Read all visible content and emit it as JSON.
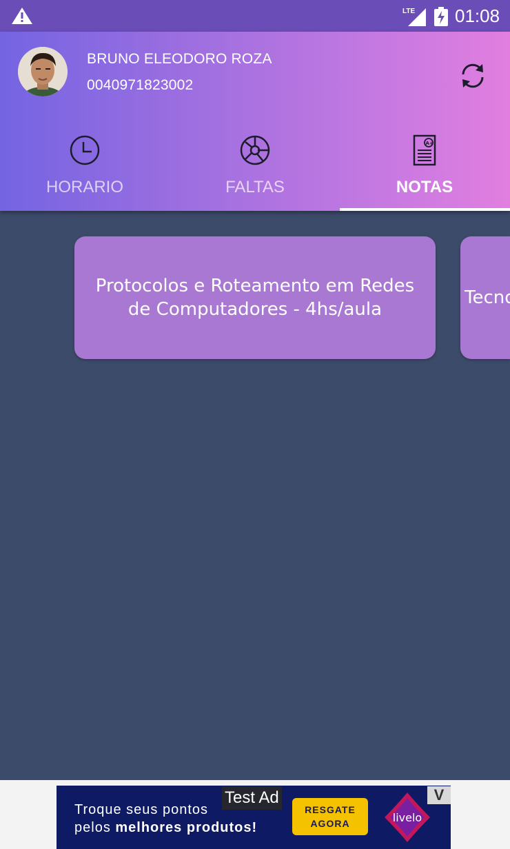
{
  "status_bar": {
    "network": "LTE",
    "time": "01:08",
    "icons": [
      "warning-icon",
      "lte-signal-icon",
      "battery-charging-icon"
    ]
  },
  "user": {
    "name": "BRUNO ELEODORO ROZA",
    "id": "0040971823002"
  },
  "header": {
    "refresh_icon": "refresh-icon"
  },
  "tabs": [
    {
      "label": "HORARIO",
      "icon": "clock-icon",
      "active": false
    },
    {
      "label": "FALTAS",
      "icon": "pie-chart-icon",
      "active": false
    },
    {
      "label": "NOTAS",
      "icon": "grade-report-icon",
      "active": true
    }
  ],
  "cards": [
    {
      "title": "Protocolos e Roteamento em Redes de Computadores - 4hs/aula"
    },
    {
      "title": "Tecno"
    }
  ],
  "ad": {
    "label": "Test Ad",
    "line1_prefix": "Troque seus pontos",
    "line2_prefix": "pelos ",
    "line2_bold": "melhores produtos!",
    "cta": "RESGATE AGORA",
    "brand": "livelo",
    "close": "V"
  },
  "colors": {
    "status_bar": "#6a4db7",
    "header_gradient_start": "#7464e2",
    "header_gradient_end": "#e27ee0",
    "background": "#3d4b6b",
    "card": "#a978d2",
    "ad_background": "#0e1a63",
    "ad_cta": "#f5c200"
  }
}
